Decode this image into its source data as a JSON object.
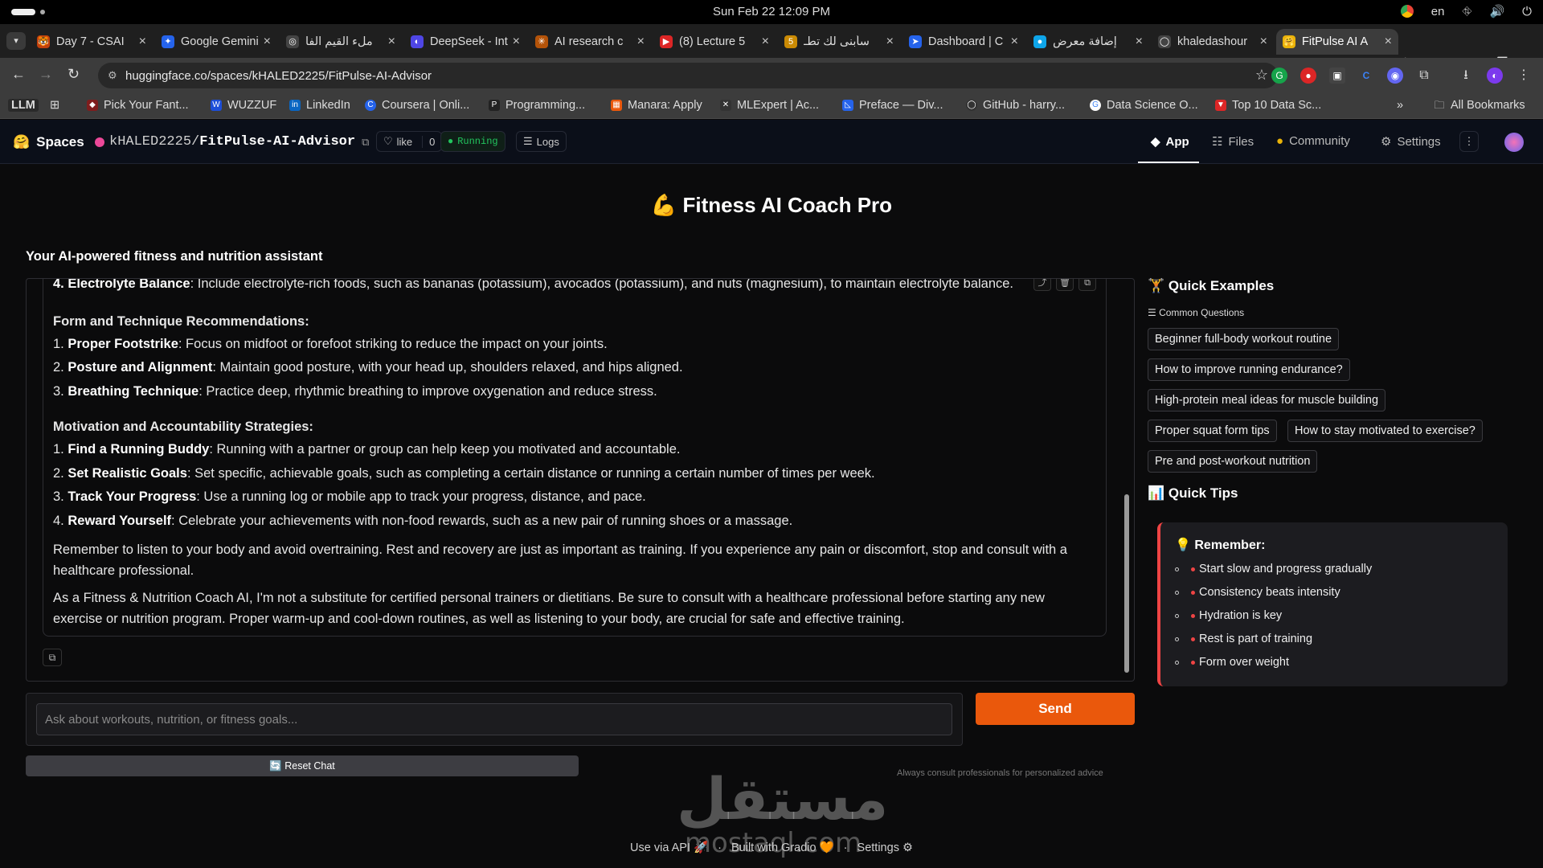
{
  "os": {
    "clock": "Sun Feb 22  12:09 PM",
    "lang": "en"
  },
  "tabs": [
    {
      "title": "Day 7 - CSAI",
      "color": "#c2410c",
      "glyph": "🐯"
    },
    {
      "title": "Google Gemini",
      "color": "#2563eb",
      "glyph": "✦"
    },
    {
      "title": "ملء القيم الفا",
      "color": "#444444",
      "glyph": "◎"
    },
    {
      "title": "DeepSeek - Into",
      "color": "#4f46e5",
      "glyph": "◐"
    },
    {
      "title": "AI research c",
      "color": "#b45309",
      "glyph": "✳"
    },
    {
      "title": "(8) Lecture 5",
      "color": "#dc2626",
      "glyph": "▶"
    },
    {
      "title": "سأبنى لك تطـ",
      "color": "#ca8a04",
      "glyph": "5"
    },
    {
      "title": "Dashboard | C",
      "color": "#2563eb",
      "glyph": "➤"
    },
    {
      "title": "إضافة معرض",
      "color": "#0ea5e9",
      "glyph": "●"
    },
    {
      "title": "khaledashour",
      "color": "#444444",
      "glyph": "◯"
    },
    {
      "title": "FitPulse AI A",
      "color": "#eab308",
      "glyph": "🤗"
    }
  ],
  "address": {
    "url": "huggingface.co/spaces/kHALED2225/FitPulse-AI-Advisor"
  },
  "bookmarks": [
    {
      "label": "LLM"
    },
    {
      "label": "Pick Your Fant..."
    },
    {
      "label": "WUZZUF"
    },
    {
      "label": "LinkedIn"
    },
    {
      "label": "Coursera | Onli..."
    },
    {
      "label": "Programming..."
    },
    {
      "label": "Manara: Apply"
    },
    {
      "label": "MLExpert | Ac..."
    },
    {
      "label": "Preface — Div..."
    },
    {
      "label": "GitHub - harry..."
    },
    {
      "label": "Data Science O..."
    },
    {
      "label": "Top 10 Data Sc..."
    },
    {
      "label": "All Bookmarks"
    }
  ],
  "hf": {
    "spaces": "Spaces",
    "owner": "kHALED2225",
    "sep": "/",
    "repo": "FitPulse-AI-Advisor",
    "like": "like",
    "likes": "0",
    "status": "Running",
    "logs": "Logs",
    "tabs": {
      "app": "App",
      "files": "Files",
      "community": "Community",
      "settings": "Settings"
    }
  },
  "app": {
    "title": "💪 Fitness AI Coach Pro",
    "subtitle": "Your AI-powered fitness and nutrition assistant",
    "message": {
      "cut_line_bold": "4. Electrolyte Balance",
      "cut_line_text": ": Include electrolyte-rich foods, such as bananas (potassium), avocados (potassium), and nuts (magnesium), to maintain electrolyte balance.",
      "section1": "Form and Technique Recommendations:",
      "s1_items": [
        {
          "num": "1. ",
          "bold": "Proper Footstrike",
          "text": ": Focus on midfoot or forefoot striking to reduce the impact on your joints."
        },
        {
          "num": "2. ",
          "bold": "Posture and Alignment",
          "text": ": Maintain good posture, with your head up, shoulders relaxed, and hips aligned."
        },
        {
          "num": "3. ",
          "bold": "Breathing Technique",
          "text": ": Practice deep, rhythmic breathing to improve oxygenation and reduce stress."
        }
      ],
      "section2": "Motivation and Accountability Strategies:",
      "s2_items": [
        {
          "num": "1. ",
          "bold": "Find a Running Buddy",
          "text": ": Running with a partner or group can help keep you motivated and accountable."
        },
        {
          "num": "2. ",
          "bold": "Set Realistic Goals",
          "text": ": Set specific, achievable goals, such as completing a certain distance or running a certain number of times per week."
        },
        {
          "num": "3. ",
          "bold": "Track Your Progress",
          "text": ": Use a running log or mobile app to track your progress, distance, and pace."
        },
        {
          "num": "4. ",
          "bold": "Reward Yourself",
          "text": ": Celebrate your achievements with non-food rewards, such as a new pair of running shoes or a massage."
        }
      ],
      "para1": "Remember to listen to your body and avoid overtraining. Rest and recovery are just as important as training. If you experience any pain or discomfort, stop and consult with a healthcare professional.",
      "para2": "As a Fitness & Nutrition Coach AI, I'm not a substitute for certified personal trainers or dietitians. Be sure to consult with a healthcare professional before starting any new exercise or nutrition program. Proper warm-up and cool-down routines, as well as listening to your body, are crucial for safe and effective training."
    },
    "input_placeholder": "Ask about workouts, nutrition, or fitness goals...",
    "input_value": "",
    "send": "Send",
    "reset": "🔄 Reset Chat",
    "disclaimer": "Always consult professionals for personalized advice",
    "quick_examples_title": "🏋 Quick Examples",
    "common_questions": "☰ Common Questions",
    "examples": [
      "Beginner full-body workout routine",
      "How to improve running endurance?",
      "High-protein meal ideas for muscle building",
      "Proper squat form tips",
      "How to stay motivated to exercise?",
      "Pre and post-workout nutrition"
    ],
    "quick_tips_title": "📊 Quick Tips",
    "tips_title": "💡 Remember:",
    "tips": [
      "Start slow and progress gradually",
      "Consistency beats intensity",
      "Hydration is key",
      "Rest is part of training",
      "Form over weight"
    ]
  },
  "footer": {
    "api": "Use via API 🚀",
    "built": "Built with Gradio 🧡",
    "settings": "Settings ⚙",
    "sep": "·"
  },
  "watermark": {
    "arabic": "مستقل",
    "latin": "mostaql.com"
  },
  "colors": {
    "accent": "#ea580c",
    "tip_border": "#ef4444",
    "status": "#22c55e"
  }
}
